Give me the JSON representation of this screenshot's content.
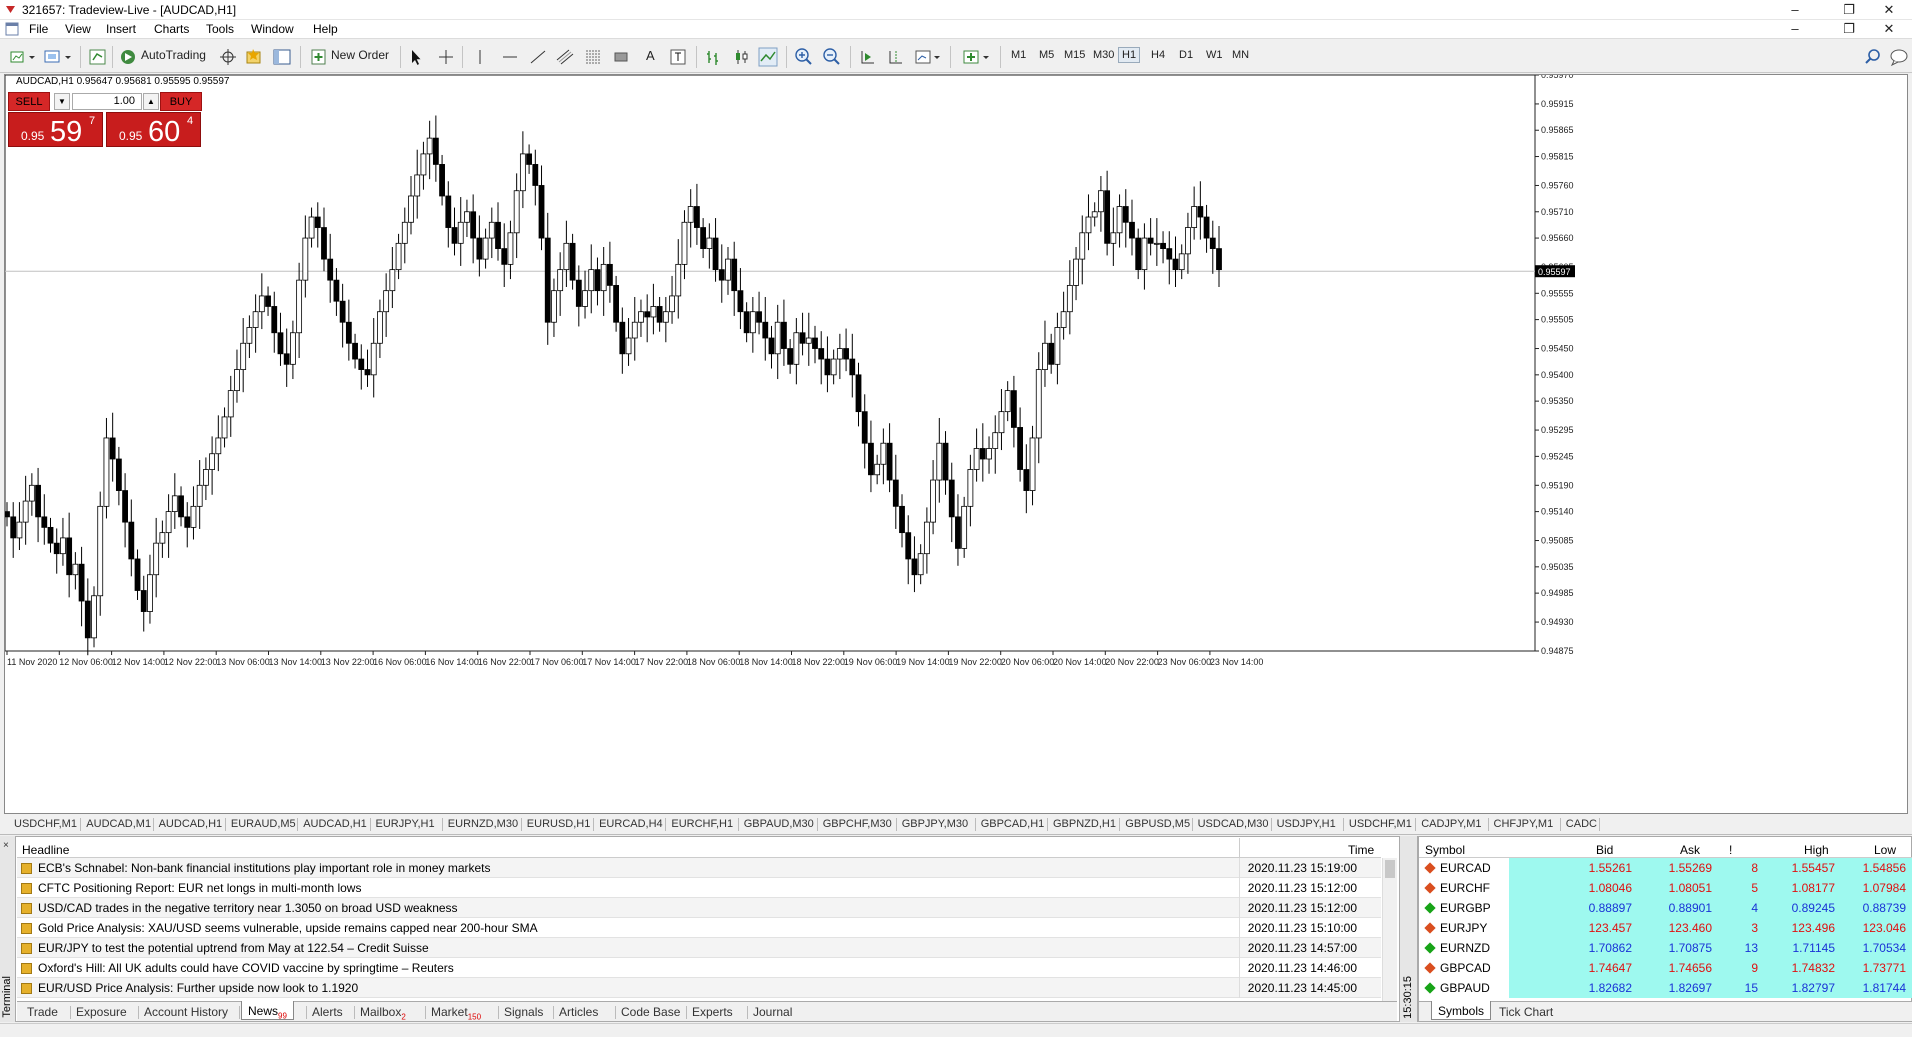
{
  "window": {
    "title": "321657: Tradeview-Live - [AUDCAD,H1]"
  },
  "menu": [
    "File",
    "View",
    "Insert",
    "Charts",
    "Tools",
    "Window",
    "Help"
  ],
  "toolbar": {
    "autotrading_label": "AutoTrading",
    "new_order_label": "New Order",
    "timeframes": [
      "M1",
      "M5",
      "M15",
      "M30",
      "H1",
      "H4",
      "D1",
      "W1",
      "MN"
    ],
    "active_timeframe": "H1",
    "text_tool": "A"
  },
  "chart": {
    "info": "AUDCAD,H1  0.95647 0.95681 0.95595 0.95597",
    "one_click": {
      "sell_label": "SELL",
      "buy_label": "BUY",
      "lot": "1.00",
      "sell_small": "0.95",
      "sell_big": "59",
      "sell_sup": "7",
      "buy_small": "0.95",
      "buy_big": "60",
      "buy_sup": "4"
    },
    "current_price_label": "0.95597"
  },
  "chart_data": {
    "type": "candlestick",
    "title": "",
    "xlabel": "",
    "ylabel": "",
    "ylim": [
      0.94875,
      0.9597
    ],
    "current_price": 0.95597,
    "y_ticks": [
      "0.95970",
      "0.95915",
      "0.95865",
      "0.95815",
      "0.95760",
      "0.95710",
      "0.95660",
      "0.95605",
      "0.95555",
      "0.95505",
      "0.95450",
      "0.95400",
      "0.95350",
      "0.95295",
      "0.95245",
      "0.95190",
      "0.95140",
      "0.95085",
      "0.95035",
      "0.94985",
      "0.94930",
      "0.94875"
    ],
    "y_tick_values": [
      0.9597,
      0.95915,
      0.95865,
      0.95815,
      0.9576,
      0.9571,
      0.9566,
      0.95605,
      0.95555,
      0.95505,
      0.9545,
      0.954,
      0.9535,
      0.95295,
      0.95245,
      0.9519,
      0.9514,
      0.95085,
      0.95035,
      0.94985,
      0.9493,
      0.94875
    ],
    "x_ticks": [
      "11 Nov 2020",
      "12 Nov 06:00",
      "12 Nov 14:00",
      "12 Nov 22:00",
      "13 Nov 06:00",
      "13 Nov 14:00",
      "13 Nov 22:00",
      "16 Nov 06:00",
      "16 Nov 14:00",
      "16 Nov 22:00",
      "17 Nov 06:00",
      "17 Nov 14:00",
      "17 Nov 22:00",
      "18 Nov 06:00",
      "18 Nov 14:00",
      "18 Nov 22:00",
      "19 Nov 06:00",
      "19 Nov 14:00",
      "19 Nov 22:00",
      "20 Nov 06:00",
      "20 Nov 14:00",
      "20 Nov 22:00",
      "23 Nov 06:00",
      "23 Nov 14:00"
    ],
    "closes": [
      0.9513,
      0.9509,
      0.9512,
      0.9516,
      0.9519,
      0.9513,
      0.9511,
      0.9508,
      0.9506,
      0.9509,
      0.9502,
      0.9504,
      0.9497,
      0.949,
      0.9498,
      0.9515,
      0.9528,
      0.9524,
      0.9518,
      0.9512,
      0.9505,
      0.9499,
      0.9495,
      0.9502,
      0.9508,
      0.951,
      0.9514,
      0.9517,
      0.9513,
      0.9511,
      0.9515,
      0.9519,
      0.9522,
      0.9525,
      0.9528,
      0.9532,
      0.9537,
      0.9541,
      0.9546,
      0.9549,
      0.9552,
      0.9555,
      0.9553,
      0.9548,
      0.9544,
      0.9542,
      0.9548,
      0.9558,
      0.9566,
      0.957,
      0.9568,
      0.9562,
      0.9558,
      0.9554,
      0.955,
      0.9546,
      0.9543,
      0.9541,
      0.954,
      0.9546,
      0.9552,
      0.9556,
      0.956,
      0.9565,
      0.9569,
      0.9574,
      0.9578,
      0.9582,
      0.9585,
      0.958,
      0.9574,
      0.9568,
      0.9565,
      0.9569,
      0.9571,
      0.9566,
      0.9562,
      0.9566,
      0.9569,
      0.9564,
      0.9561,
      0.9567,
      0.9575,
      0.9582,
      0.958,
      0.9576,
      0.9566,
      0.955,
      0.9556,
      0.956,
      0.9565,
      0.9558,
      0.9553,
      0.9556,
      0.956,
      0.9556,
      0.9561,
      0.9557,
      0.955,
      0.9544,
      0.9547,
      0.955,
      0.9552,
      0.9551,
      0.9553,
      0.955,
      0.9552,
      0.9555,
      0.9561,
      0.9569,
      0.9572,
      0.9568,
      0.9564,
      0.9566,
      0.956,
      0.9558,
      0.9562,
      0.9556,
      0.9552,
      0.9548,
      0.9552,
      0.955,
      0.9547,
      0.9544,
      0.955,
      0.9545,
      0.9542,
      0.9548,
      0.9546,
      0.9547,
      0.9545,
      0.9543,
      0.954,
      0.9543,
      0.9545,
      0.9543,
      0.954,
      0.9533,
      0.9527,
      0.9521,
      0.9523,
      0.9527,
      0.952,
      0.9515,
      0.951,
      0.9505,
      0.9502,
      0.9506,
      0.9512,
      0.952,
      0.9527,
      0.952,
      0.9513,
      0.9507,
      0.9515,
      0.9522,
      0.9526,
      0.9524,
      0.9526,
      0.9529,
      0.9533,
      0.9537,
      0.953,
      0.9522,
      0.9518,
      0.9528,
      0.9541,
      0.9546,
      0.9542,
      0.9549,
      0.9552,
      0.9557,
      0.9562,
      0.9567,
      0.957,
      0.9571,
      0.9575,
      0.9565,
      0.9567,
      0.9572,
      0.9569,
      0.9566,
      0.956,
      0.9566,
      0.9565,
      0.9565,
      0.9564,
      0.9562,
      0.956,
      0.9563,
      0.9568,
      0.9572,
      0.957,
      0.9566,
      0.9564,
      0.956
    ]
  },
  "chart_tabs": [
    "USDCHF,M1",
    "AUDCAD,M1",
    "AUDCAD,H1",
    "EURAUD,M5",
    "AUDCAD,H1",
    "EURJPY,H1",
    "EURNZD,M30",
    "EURUSD,H1",
    "EURCAD,H4",
    "EURCHF,H1",
    "GBPAUD,M30",
    "GBPCHF,M30",
    "GBPJPY,M30",
    "GBPCAD,H1",
    "GBPNZD,H1",
    "GBPUSD,M5",
    "USDCAD,M30",
    "USDJPY,H1",
    "USDCHF,M1",
    "CADJPY,M1",
    "CHFJPY,M1",
    "CADC"
  ],
  "terminal": {
    "side_label": "Terminal",
    "close_icon": "×",
    "headline_header": "Headline",
    "time_header": "Time",
    "news": [
      {
        "headline": "ECB's Schnabel: Non-bank financial institutions play important role in money markets",
        "time": "2020.11.23 15:19:00"
      },
      {
        "headline": "CFTC Positioning Report: EUR net longs in multi-month lows",
        "time": "2020.11.23 15:12:00"
      },
      {
        "headline": "USD/CAD trades in the negative territory near 1.3050 on broad USD weakness",
        "time": "2020.11.23 15:12:00"
      },
      {
        "headline": "Gold Price Analysis: XAU/USD seems vulnerable, upside remains capped near 200-hour SMA",
        "time": "2020.11.23 15:10:00"
      },
      {
        "headline": "EUR/JPY to test the potential uptrend from May at 122.54 – Credit Suisse",
        "time": "2020.11.23 14:57:00"
      },
      {
        "headline": "Oxford's Hill: All UK adults could have COVID vaccine by springtime – Reuters",
        "time": "2020.11.23 14:46:00"
      },
      {
        "headline": "EUR/USD Price Analysis: Further upside now look to 1.1920",
        "time": "2020.11.23 14:45:00"
      }
    ],
    "tabs": [
      {
        "label": "Trade"
      },
      {
        "label": "Exposure"
      },
      {
        "label": "Account History"
      },
      {
        "label": "News",
        "badge": "99"
      },
      {
        "label": "Alerts"
      },
      {
        "label": "Mailbox",
        "badge": "2"
      },
      {
        "label": "Market",
        "badge": "150"
      },
      {
        "label": "Signals"
      },
      {
        "label": "Articles"
      },
      {
        "label": "Code Base"
      },
      {
        "label": "Experts"
      },
      {
        "label": "Journal"
      }
    ],
    "active_tab": "News"
  },
  "market_watch": {
    "side_label": "15:30:15",
    "headers": {
      "symbol": "Symbol",
      "bid": "Bid",
      "ask": "Ask",
      "spread": "!",
      "high": "High",
      "low": "Low"
    },
    "rows": [
      {
        "symbol": "EURCAD",
        "bid": "1.55261",
        "ask": "1.55269",
        "spread": "8",
        "high": "1.55457",
        "low": "1.54856",
        "dir": "down"
      },
      {
        "symbol": "EURCHF",
        "bid": "1.08046",
        "ask": "1.08051",
        "spread": "5",
        "high": "1.08177",
        "low": "1.07984",
        "dir": "down"
      },
      {
        "symbol": "EURGBP",
        "bid": "0.88897",
        "ask": "0.88901",
        "spread": "4",
        "high": "0.89245",
        "low": "0.88739",
        "dir": "up"
      },
      {
        "symbol": "EURJPY",
        "bid": "123.457",
        "ask": "123.460",
        "spread": "3",
        "high": "123.496",
        "low": "123.046",
        "dir": "down"
      },
      {
        "symbol": "EURNZD",
        "bid": "1.70862",
        "ask": "1.70875",
        "spread": "13",
        "high": "1.71145",
        "low": "1.70534",
        "dir": "up"
      },
      {
        "symbol": "GBPCAD",
        "bid": "1.74647",
        "ask": "1.74656",
        "spread": "9",
        "high": "1.74832",
        "low": "1.73771",
        "dir": "down"
      },
      {
        "symbol": "GBPAUD",
        "bid": "1.82682",
        "ask": "1.82697",
        "spread": "15",
        "high": "1.82797",
        "low": "1.81744",
        "dir": "up"
      }
    ],
    "tabs": [
      "Symbols",
      "Tick Chart"
    ],
    "active_tab": "Symbols"
  },
  "colors": {
    "sell_red": "#c81d1d",
    "bid_up": "#1a33d6",
    "bid_down": "#e01010",
    "highlight": "#9ef9ef",
    "diamond_up": "#17a317",
    "diamond_down": "#d94e1f"
  },
  "icons": {
    "new-chart": "new-chart-icon",
    "profiles": "profiles-icon",
    "market-watch": "market-watch-icon",
    "navigator": "navigator-icon",
    "autotrading": "autotrading-icon",
    "crosshair": "crosshair-icon",
    "cursor": "cursor-icon",
    "zoom-in": "zoom-in-icon",
    "zoom-out": "zoom-out-icon",
    "search": "search-icon"
  }
}
